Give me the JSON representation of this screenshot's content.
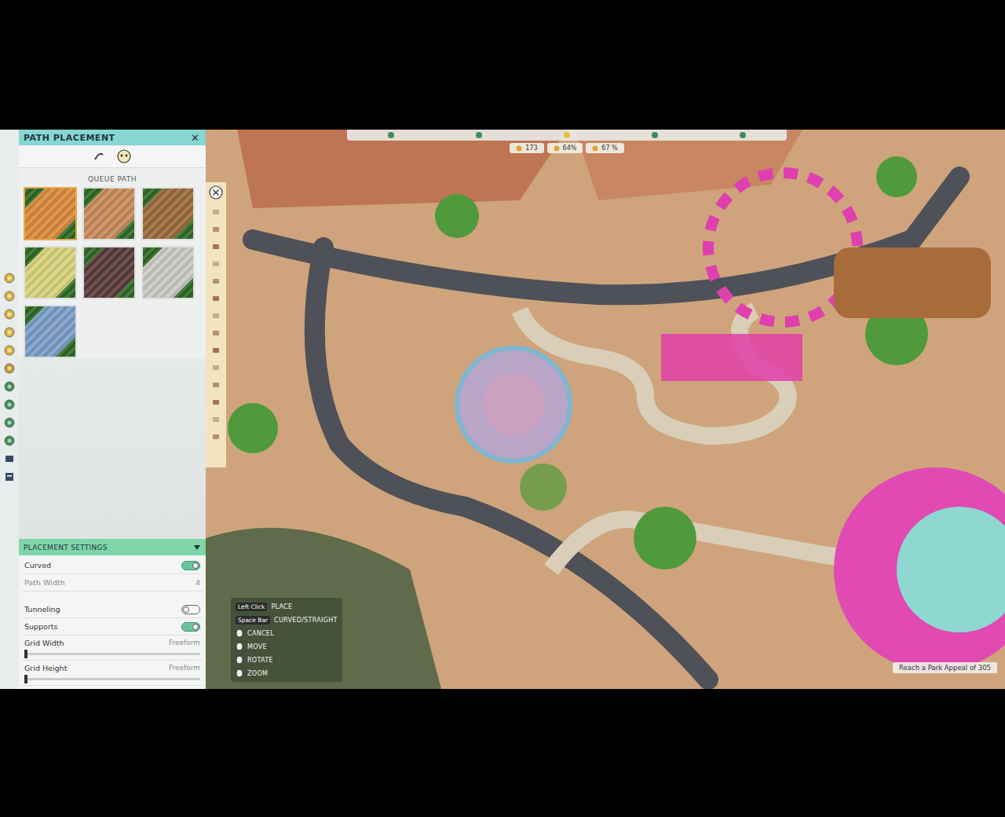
{
  "panel": {
    "title": "PATH PLACEMENT",
    "close": "✕",
    "section": "QUEUE PATH",
    "tiles": [
      {
        "selected": true,
        "color": "#d98a3a"
      },
      {
        "selected": false,
        "color": "#c88a5a"
      },
      {
        "selected": false,
        "color": "#9a6a3a"
      },
      {
        "selected": false,
        "color": "#d8d27a"
      },
      {
        "selected": false,
        "color": "#5a3a3a"
      },
      {
        "selected": false,
        "color": "#c8c8c4"
      },
      {
        "selected": false,
        "color": "#7a9ec8"
      }
    ]
  },
  "settings": {
    "title": "PLACEMENT SETTINGS",
    "rows": [
      {
        "label": "Curved",
        "kind": "toggle",
        "on": true
      },
      {
        "label": "Path Width",
        "kind": "value",
        "value": "4",
        "disabled": true
      },
      {
        "label": "Tunneling",
        "kind": "toggle",
        "on": false
      },
      {
        "label": "Supports",
        "kind": "toggle",
        "on": true
      },
      {
        "label": "Grid Width",
        "kind": "slider",
        "value": "Freeform",
        "level": 0
      },
      {
        "label": "Grid Height",
        "kind": "slider",
        "value": "Freeform",
        "level": 0
      }
    ]
  },
  "hud": {
    "stats": [
      "173",
      "64%",
      "67 %"
    ]
  },
  "controls": [
    {
      "key": "Left Click",
      "action": "PLACE"
    },
    {
      "key": "Space Bar",
      "action": "CURVED/STRAIGHT"
    },
    {
      "key": "",
      "action": "CANCEL"
    },
    {
      "key": "",
      "action": "MOVE"
    },
    {
      "key": "",
      "action": "ROTATE"
    },
    {
      "key": "",
      "action": "ZOOM"
    }
  ],
  "objective": "Reach a Park Appeal of 305"
}
